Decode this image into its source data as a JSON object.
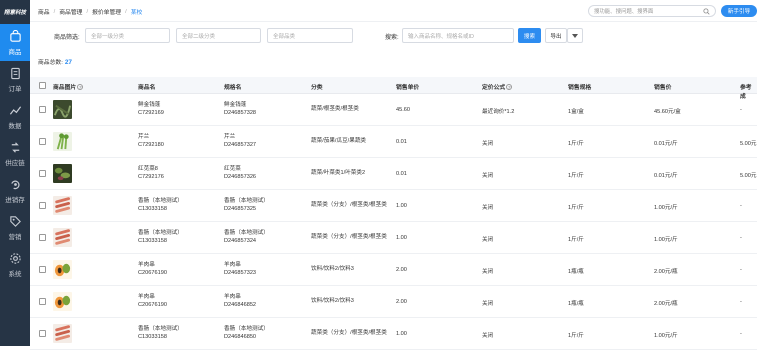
{
  "app": {
    "logo_text": "翔意科技"
  },
  "sidebar": {
    "items": [
      {
        "label": "商品",
        "icon": "bag-icon",
        "active": true
      },
      {
        "label": "订单",
        "icon": "order-icon",
        "active": false
      },
      {
        "label": "数据",
        "icon": "chart-icon",
        "active": false
      },
      {
        "label": "供应链",
        "icon": "supply-chain-icon",
        "active": false
      },
      {
        "label": "进销存",
        "icon": "inventory-icon",
        "active": false
      },
      {
        "label": "营销",
        "icon": "tag-icon",
        "active": false
      },
      {
        "label": "系统",
        "icon": "gear-icon",
        "active": false
      }
    ]
  },
  "breadcrumb": [
    "商品",
    "商品管理",
    "报价单管理",
    "某校"
  ],
  "topbar": {
    "search_placeholder": "搜功能、搜问题、搜界面",
    "help_button": "新手引导"
  },
  "filters": {
    "category_label": "商品筛选:",
    "level1_placeholder": "全部一级分类",
    "level2_placeholder": "全部二级分类",
    "brand_placeholder": "全部品类",
    "search_label": "搜索:",
    "search_placeholder": "输入商品名称、规格名或ID",
    "search_button": "搜索",
    "export_button": "导出"
  },
  "summary": {
    "label": "商品总数:",
    "count": "27"
  },
  "table": {
    "columns": [
      "商品图片",
      "商品名",
      "规格名",
      "分类",
      "销售单价",
      "定价公式",
      "销售规格",
      "销售价",
      "参考成"
    ],
    "rows": [
      {
        "image": "seaweed",
        "name": "鲜金钱蓬",
        "code": "C7292169",
        "spec": "鲜金钱蓬",
        "spec_code": "D246857328",
        "category": "蔬菜/根茎类/根茎类",
        "unit_price": "45.60",
        "formula": "最近询价*1.2",
        "sale_spec": "1盒/盒",
        "sale_price": "45.60元/盒",
        "ref": "-"
      },
      {
        "image": "celery",
        "name": "芹兰",
        "code": "C7292180",
        "spec": "芹兰",
        "spec_code": "D246857327",
        "category": "蔬菜/茄果/瓜豆/果蔬类",
        "unit_price": "0.01",
        "formula": "关闭",
        "sale_spec": "1斤/斤",
        "sale_price": "0.01元/斤",
        "ref": "5.00元"
      },
      {
        "image": "greens",
        "name": "红苋菜8",
        "code": "C7292176",
        "spec": "红苋菜",
        "spec_code": "D246857326",
        "category": "蔬菜/叶菜类1/叶菜类2",
        "unit_price": "0.01",
        "formula": "关闭",
        "sale_spec": "1斤/斤",
        "sale_price": "0.01元/斤",
        "ref": "5.00元"
      },
      {
        "image": "pork",
        "name": "香肠（本地测试）",
        "code": "C13033158",
        "spec": "香肠（本地测试）",
        "spec_code": "D246857325",
        "category": "蔬菜类（分支）/根茎类/根茎类",
        "unit_price": "1.00",
        "formula": "关闭",
        "sale_spec": "1斤/斤",
        "sale_price": "1.00元/斤",
        "ref": "-"
      },
      {
        "image": "pork",
        "name": "香肠（本地测试）",
        "code": "C13033158",
        "spec": "香肠（本地测试）",
        "spec_code": "D246857324",
        "category": "蔬菜类（分支）/根茎类/根茎类",
        "unit_price": "1.00",
        "formula": "关闭",
        "sale_spec": "1斤/斤",
        "sale_price": "1.00元/斤",
        "ref": "-"
      },
      {
        "image": "papaya",
        "name": "羊肉串",
        "code": "C20676190",
        "spec": "羊肉串",
        "spec_code": "D246857323",
        "category": "饮料/饮料2/饮料3",
        "unit_price": "2.00",
        "formula": "关闭",
        "sale_spec": "1瓶/瓶",
        "sale_price": "2.00元/瓶",
        "ref": "-"
      },
      {
        "image": "papaya",
        "name": "羊肉串",
        "code": "C20676190",
        "spec": "羊肉串",
        "spec_code": "D246846852",
        "category": "饮料/饮料2/饮料3",
        "unit_price": "2.00",
        "formula": "关闭",
        "sale_spec": "1瓶/瓶",
        "sale_price": "2.00元/瓶",
        "ref": "-"
      },
      {
        "image": "pork",
        "name": "香肠（本地测试）",
        "code": "C13033158",
        "spec": "香肠（本地测试）",
        "spec_code": "D246846850",
        "category": "蔬菜类（分支）/根茎类/根茎类",
        "unit_price": "1.00",
        "formula": "关闭",
        "sale_spec": "1斤/斤",
        "sale_price": "1.00元/斤",
        "ref": "-"
      }
    ]
  },
  "colors": {
    "sidebar_bg": "#263445",
    "accent": "#2d8cf0",
    "active_nav": "#1f8bef"
  }
}
